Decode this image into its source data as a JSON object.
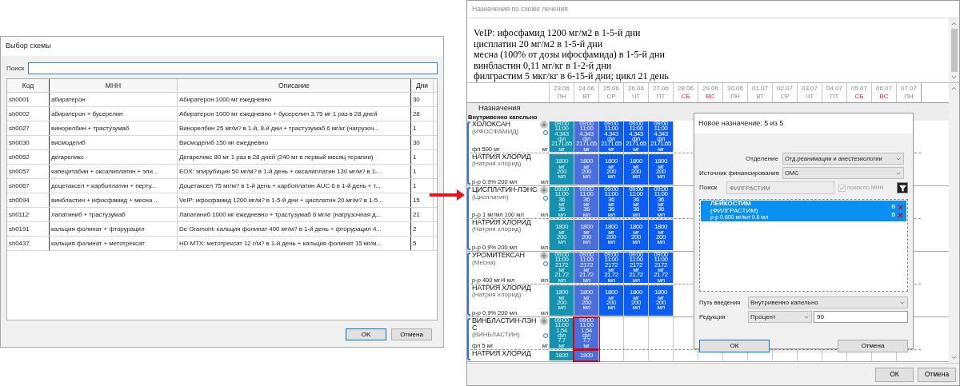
{
  "left_dialog": {
    "title": "Выбор схемы",
    "search": {
      "label": "Поиск"
    },
    "columns": [
      "Код",
      "МНН",
      "Описание",
      "Дни"
    ],
    "rows": [
      {
        "cells": [
          "sh0001",
          "абиратерон",
          "Абиратерон 1000 мг ежедневно",
          "30"
        ]
      },
      {
        "cells": [
          "sh0002",
          "абиратерон + бусерелин",
          "Абиратерон 1000 мг ежедневно + бусерелин 3,75 мг 1 раз в 28 дней",
          "28"
        ]
      },
      {
        "cells": [
          "sh0027",
          "винорелбин + трастузумаб",
          "Винорелбин 25 мг/м? в 1-й, 8-й дни + трастузумаб 6 мг/кг (нагрузоч...",
          "1"
        ]
      },
      {
        "cells": [
          "sh0030",
          "висмодегиб",
          "Висмодегиб 150 мг ежедневно",
          "30"
        ]
      },
      {
        "cells": [
          "sh0052",
          "дегареликс",
          "Дегареликс 80 мг 1 раз в 28 дней (240 мг в первый месяц терапии)",
          "1"
        ]
      },
      {
        "cells": [
          "sh0057",
          "капецитабин + оксалиплатин + эпи...",
          "EOX: эпирубицин 50 мг/м? в 1-й день + оксалиплатин 130 мг/м? в 1-...",
          "1"
        ]
      },
      {
        "cells": [
          "sh0067",
          "доцетаксел + карбоплатин + перту...",
          "Доцетаксел 75 мг/м? в 1-й день + карбоплатин AUC 6 в 1-й день + т...",
          "1"
        ]
      },
      {
        "cells": [
          "sh0094",
          "винбластин + ифосфамид + месна ...",
          "VeIP: ифосфамид 1200 мг/м? в 1-5-й дни + цисплатин 20 мг/м? в 1-5...",
          "15"
        ]
      },
      {
        "cells": [
          "sh0112",
          "лапатиниб + трастузумаб",
          "Лапатиниб 1000 мг ежедневно + трастузумаб 6 мг/кг (нагрузочная д...",
          "21"
        ]
      },
      {
        "cells": [
          "sh0191",
          "кальция фолинат + фторурацил",
          "De Gramont: кальция фолинат 400 мг/м? в 1-й день + фторурацил 4...",
          "2"
        ]
      },
      {
        "cells": [
          "sh0437",
          "кальция фолинат + метотрексат",
          "HD MTX: метотрексат 12 г/м? в 1-й день + кальция фолинат 15 мг/м...",
          "5"
        ]
      }
    ],
    "buttons": [
      "OK",
      "Отмена"
    ]
  },
  "right_window": {
    "title": "Назначения по схеме лечения",
    "scheme_lines": [
      "VeIP: ифосфамид 1200 мг/м2 в 1-5-й дни",
      "цисплатин 20 мг/м2 в 1-5-й дни",
      "месна (100% от дозы ифосфамида) в 1-5-й дни",
      "винбластин 0,11 мг/кг в 1-2-й дни",
      "филграстим 5 мкг/кг в 6-15-й дни; цикл 21 день"
    ],
    "dates": [
      {
        "date": "23.06",
        "weekday": "ПН",
        "weekend": false
      },
      {
        "date": "24.06",
        "weekday": "ВТ",
        "weekend": false
      },
      {
        "date": "25.06",
        "weekday": "СР",
        "weekend": false
      },
      {
        "date": "26.06",
        "weekday": "ЧТ",
        "weekend": false
      },
      {
        "date": "27.06",
        "weekday": "ПТ",
        "weekend": false
      },
      {
        "date": "28.06",
        "weekday": "СБ",
        "weekend": true
      },
      {
        "date": "29.06",
        "weekday": "ВС",
        "weekend": true
      },
      {
        "date": "30.06",
        "weekday": "ПН",
        "weekend": false
      },
      {
        "date": "01.07",
        "weekday": "ВТ",
        "weekend": false
      },
      {
        "date": "02.07",
        "weekday": "СР",
        "weekend": false
      },
      {
        "date": "03.07",
        "weekday": "ЧТ",
        "weekend": false
      },
      {
        "date": "04.07",
        "weekday": "ПТ",
        "weekend": false
      },
      {
        "date": "05.07",
        "weekday": "СБ",
        "weekend": true
      },
      {
        "date": "06.07",
        "weekday": "ВС",
        "weekend": true
      },
      {
        "date": "07.07",
        "weekday": "ПН",
        "weekend": false
      }
    ],
    "section": "Назначения",
    "route": "Внутривенно капельно",
    "groups": [
      {
        "drugs": [
          {
            "name": "ХОЛОКСАН",
            "inn": "(ИФОСФАМИД)",
            "form": "фл 500 мг",
            "unit": "мг",
            "plus": true,
            "dose_circle": true,
            "cells": [
              {
                "kind": "teal",
                "selected": false,
                "lines": [
                  "09:00",
                  "11:00",
                  "4.343",
                  "фл",
                  "2171.65",
                  "мг"
                ]
              },
              {
                "kind": "violet",
                "selected": false,
                "lines": [
                  "09:00",
                  "11:00",
                  "4.343",
                  "фл",
                  "2171.65",
                  "мг"
                ]
              },
              {
                "kind": "blue",
                "selected": false,
                "lines": [
                  "09:00",
                  "11:00",
                  "4.343",
                  "фл",
                  "2171.65",
                  "мг"
                ]
              },
              {
                "kind": "blue",
                "selected": false,
                "lines": [
                  "09:00",
                  "11:00",
                  "4.343",
                  "фл",
                  "2171.65",
                  "мг"
                ]
              },
              {
                "kind": "blue",
                "selected": false,
                "lines": [
                  "09:00",
                  "11:00",
                  "4.343",
                  "фл",
                  "2171.65",
                  "мг"
                ]
              }
            ]
          },
          {
            "name": "НАТРИЯ ХЛОРИД",
            "inn": "(Натрия хлорид)",
            "form": "р-р 0,9% 200 мл",
            "unit": "мл",
            "plus": false,
            "dose_circle": false,
            "cells": [
              {
                "kind": "teal",
                "selected": false,
                "lines": [
                  "1800",
                  "мг",
                  "200",
                  "мл"
                ]
              },
              {
                "kind": "violet",
                "selected": false,
                "lines": [
                  "1800",
                  "мг",
                  "200",
                  "мл"
                ]
              },
              {
                "kind": "blue",
                "selected": false,
                "lines": [
                  "1800",
                  "мг",
                  "200",
                  "мл"
                ]
              },
              {
                "kind": "blue",
                "selected": false,
                "lines": [
                  "1800",
                  "мг",
                  "200",
                  "мл"
                ]
              },
              {
                "kind": "blue",
                "selected": false,
                "lines": [
                  "1800",
                  "мг",
                  "200",
                  "мл"
                ]
              }
            ]
          }
        ]
      },
      {
        "drugs": [
          {
            "name": "ЦИСПЛАТИН-ЛЭНС",
            "inn": "(Цисплатин)",
            "form": "р-р 1 мг/мл 100 мл",
            "unit": "мл",
            "plus": true,
            "dose_circle": true,
            "cells": [
              {
                "kind": "teal",
                "selected": false,
                "lines": [
                  "09:00",
                  "11:00",
                  "36",
                  "мг",
                  "36",
                  "мл"
                ]
              },
              {
                "kind": "violet",
                "selected": false,
                "lines": [
                  "09:00",
                  "11:00",
                  "36",
                  "мг",
                  "36",
                  "мл"
                ]
              },
              {
                "kind": "blue",
                "selected": false,
                "lines": [
                  "09:00",
                  "11:00",
                  "36",
                  "мг",
                  "36",
                  "мл"
                ]
              },
              {
                "kind": "blue",
                "selected": false,
                "lines": [
                  "09:00",
                  "11:00",
                  "36",
                  "мг",
                  "36",
                  "мл"
                ]
              },
              {
                "kind": "blue",
                "selected": false,
                "lines": [
                  "09:00",
                  "11:00",
                  "36",
                  "мг",
                  "36",
                  "мл"
                ]
              }
            ]
          },
          {
            "name": "НАТРИЯ ХЛОРИД",
            "inn": "(Натрия хлорид)",
            "form": "р-р 0,9% 200 мл",
            "unit": "мл",
            "plus": false,
            "dose_circle": false,
            "cells": [
              {
                "kind": "teal",
                "selected": false,
                "lines": [
                  "1800",
                  "мг",
                  "200",
                  "мл"
                ]
              },
              {
                "kind": "violet",
                "selected": false,
                "lines": [
                  "1800",
                  "мг",
                  "200",
                  "мл"
                ]
              },
              {
                "kind": "blue",
                "selected": false,
                "lines": [
                  "1800",
                  "мг",
                  "200",
                  "мл"
                ]
              },
              {
                "kind": "blue",
                "selected": false,
                "lines": [
                  "1800",
                  "мг",
                  "200",
                  "мл"
                ]
              },
              {
                "kind": "blue",
                "selected": false,
                "lines": [
                  "1800",
                  "мг",
                  "200",
                  "мл"
                ]
              }
            ]
          }
        ]
      },
      {
        "drugs": [
          {
            "name": "УРОМИТЕКСАН",
            "inn": "(Месна)",
            "form": "р-р 400 мг/4 мл",
            "unit": "мл",
            "plus": true,
            "dose_circle": true,
            "cells": [
              {
                "kind": "teal",
                "selected": false,
                "lines": [
                  "09:00",
                  "11:00",
                  "2172",
                  "мг",
                  "21.72",
                  "мл"
                ]
              },
              {
                "kind": "violet",
                "selected": false,
                "lines": [
                  "09:00",
                  "11:00",
                  "2172",
                  "мг",
                  "21.72",
                  "мл"
                ]
              },
              {
                "kind": "blue",
                "selected": false,
                "lines": [
                  "09:00",
                  "11:00",
                  "2172",
                  "мг",
                  "21.72",
                  "мл"
                ]
              },
              {
                "kind": "blue",
                "selected": false,
                "lines": [
                  "09:00",
                  "11:00",
                  "2172",
                  "мг",
                  "21.72",
                  "мл"
                ]
              },
              {
                "kind": "blue",
                "selected": false,
                "lines": [
                  "09:00",
                  "11:00",
                  "2172",
                  "мг",
                  "21.72",
                  "мл"
                ]
              }
            ]
          },
          {
            "name": "НАТРИЯ ХЛОРИД",
            "inn": "(Натрия хлорид)",
            "form": "р-р 0,9% 200 мл",
            "unit": "мл",
            "plus": false,
            "dose_circle": false,
            "cells": [
              {
                "kind": "teal",
                "selected": false,
                "lines": [
                  "1800",
                  "мг",
                  "200",
                  "мл"
                ]
              },
              {
                "kind": "violet",
                "selected": false,
                "lines": [
                  "1800",
                  "мг",
                  "200",
                  "мл"
                ]
              },
              {
                "kind": "blue",
                "selected": false,
                "lines": [
                  "1800",
                  "мг",
                  "200",
                  "мл"
                ]
              },
              {
                "kind": "blue",
                "selected": false,
                "lines": [
                  "1800",
                  "мг",
                  "200",
                  "мл"
                ]
              },
              {
                "kind": "blue",
                "selected": false,
                "lines": [
                  "1800",
                  "мг",
                  "200",
                  "мл"
                ]
              }
            ]
          }
        ]
      },
      {
        "drugs": [
          {
            "name": "ВИНБЛАСТИН-ЛЭНС",
            "inn": "(ВИНБЛАСТИН)",
            "form": "фл 5 мг",
            "unit": "мг",
            "plus": true,
            "dose_circle": true,
            "cells": [
              {
                "kind": "teal",
                "selected": false,
                "lines": [
                  "09:00",
                  "11:00",
                  "1,54",
                  "фл",
                  "7.7",
                  "мг"
                ]
              },
              {
                "kind": "violet",
                "selected": true,
                "lines": [
                  "09:00",
                  "11:00",
                  "1,54",
                  "фл",
                  "7.7",
                  "мг"
                ]
              }
            ]
          },
          {
            "name": "НАТРИЯ ХЛОРИД",
            "plus": false,
            "dose_circle": false,
            "cells": [
              {
                "kind": "teal",
                "selected": false,
                "lines": [
                  "1800"
                ]
              },
              {
                "kind": "violet",
                "selected": true,
                "lines": [
                  "1800"
                ]
              }
            ]
          }
        ]
      }
    ],
    "buttons": [
      "ОК",
      "Отмена"
    ]
  },
  "assignment_dialog": {
    "title": "Новое назначение: 5 из 5",
    "fields": [
      {
        "label": "Отделение",
        "value": "Отд.реанимации и анестезиологии"
      },
      {
        "label": "Источник финансирования",
        "value": "ОМС"
      }
    ],
    "search": {
      "label": "Поиск",
      "value": "ФИЛГРАСТИМ",
      "disabled": true
    },
    "inn_search": {
      "label": "поиск по МНН",
      "checked": true,
      "disabled": true
    },
    "results": [
      {
        "name": "ЛЕЙКОСТИМ",
        "inn": "(ФИЛГРАСТИМ)",
        "form": "р-р 0.600 мг/мл 0.8 мл",
        "counts": [
          "0",
          "0"
        ],
        "selected": true
      }
    ],
    "route": {
      "label": "Путь введения",
      "value": "Внутривенно капельно"
    },
    "reduction": {
      "label": "Редукция",
      "mode": "Процент",
      "value": "90"
    },
    "buttons": [
      "ОК",
      "Отмена"
    ]
  }
}
